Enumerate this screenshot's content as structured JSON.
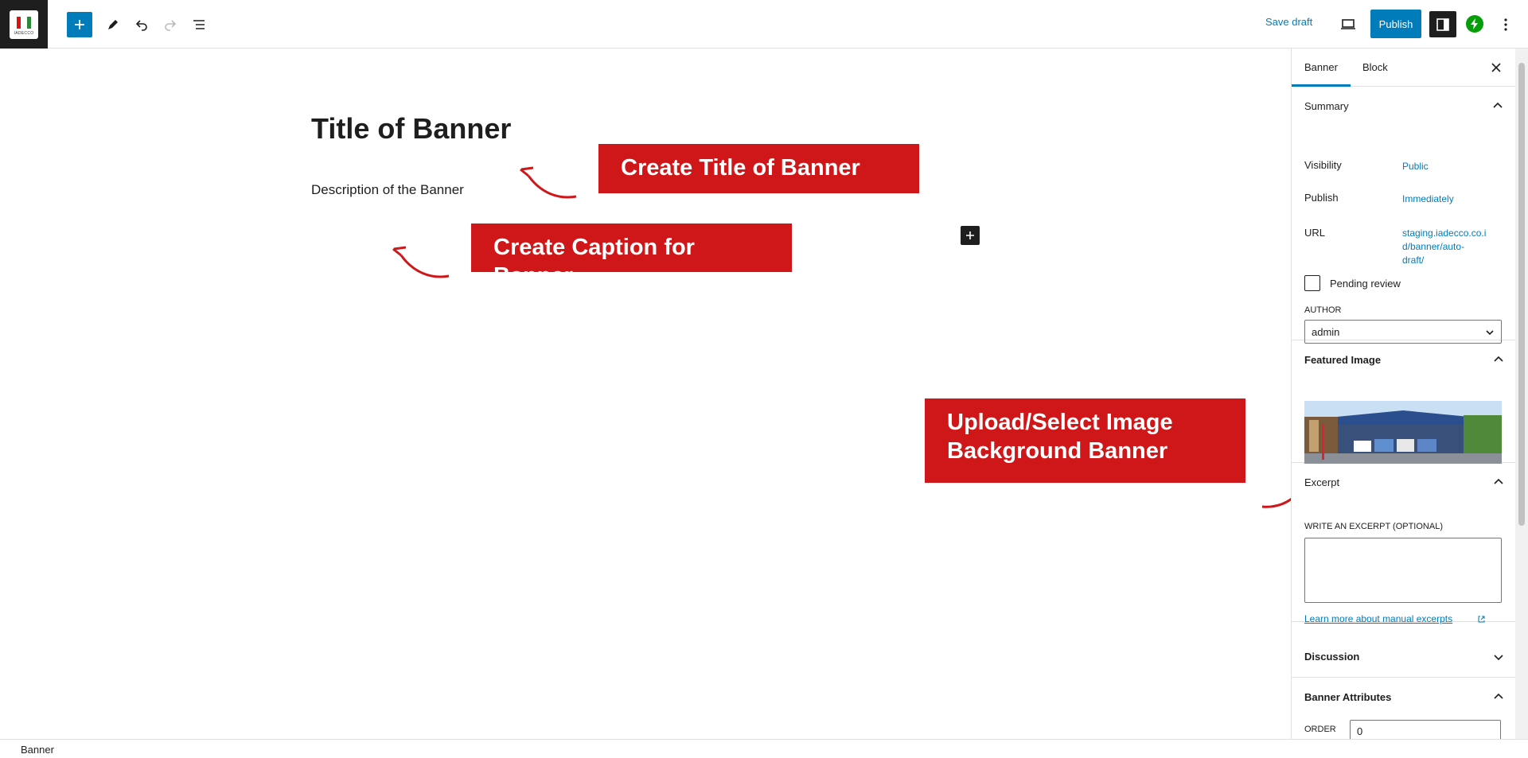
{
  "topbar": {
    "logo_text": "IADECCO",
    "save_draft": "Save draft",
    "publish": "Publish"
  },
  "editor": {
    "title": "Title of Banner",
    "description": "Description of the Banner"
  },
  "callouts": {
    "title": "Create Title of Banner",
    "caption": "Create Caption for Banner",
    "image_line1": "Upload/Select Image",
    "image_line2": "Background Banner"
  },
  "sidebar": {
    "tabs": [
      "Banner",
      "Block"
    ],
    "summary": {
      "title": "Summary",
      "visibility_label": "Visibility",
      "visibility_value": "Public",
      "publish_label": "Publish",
      "publish_value": "Immediately",
      "url_label": "URL",
      "url_value_1": "staging.iadecco.co.i",
      "url_value_2": "d/banner/auto-",
      "url_value_3": "draft/",
      "pending_review": "Pending review",
      "author_label": "AUTHOR",
      "author_value": "admin"
    },
    "featured_image": {
      "title": "Featured Image"
    },
    "excerpt": {
      "title": "Excerpt",
      "label": "WRITE AN EXCERPT (OPTIONAL)",
      "link": "Learn more about manual excerpts"
    },
    "discussion": {
      "title": "Discussion"
    },
    "banner_attributes": {
      "title": "Banner Attributes",
      "order_label": "ORDER",
      "order_value": "0"
    }
  },
  "footer": {
    "breadcrumb": "Banner"
  },
  "colors": {
    "accent": "#007cba",
    "callout": "#cf1618",
    "jetpack": "#069e08"
  }
}
